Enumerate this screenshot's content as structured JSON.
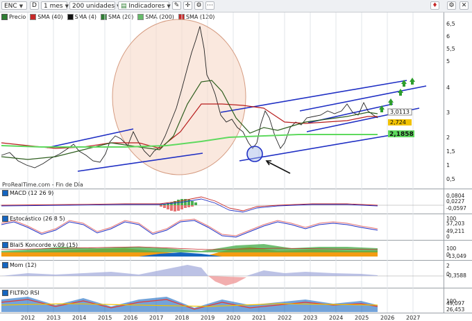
{
  "toolbar": {
    "ticker": "ENC",
    "d_label": "D",
    "period": "1 mes",
    "units": "200 unidades",
    "indicators": "Indicadores"
  },
  "legend": [
    {
      "label": "Precio",
      "color": "#333333"
    },
    {
      "label": "SMA (40)",
      "color": "#c62828"
    },
    {
      "label": "SMA (4)",
      "color": "#111111"
    },
    {
      "label": "SMA (20)",
      "color": "#2e7d32"
    },
    {
      "label": "SMA (200)",
      "color": "#66bb6a"
    },
    {
      "label": "SMA (120)",
      "color": "#c62828"
    }
  ],
  "source_label": "ProRealTime.com - Fin de Día",
  "price_axis": {
    "ticks": [
      "6,5",
      "6",
      "5,5",
      "5",
      "4",
      "3",
      "2",
      "1,5",
      "1",
      "0,5"
    ]
  },
  "price_badges": {
    "p1": "3,0113",
    "p2": "2,724",
    "p3": "2,1858"
  },
  "panels": [
    {
      "label": "MACD (12 26 9)",
      "ticks": [
        "0,0804",
        "0,0227",
        "-0,0597"
      ]
    },
    {
      "label": "Estocástico (26 8 5)",
      "ticks": [
        "100",
        "57,203",
        "49,211",
        "0"
      ]
    },
    {
      "label": "Blai5 Koncorde v.09 (15)",
      "ticks": [
        "100",
        "0",
        "-13,049"
      ]
    },
    {
      "label": "Mom (12)",
      "ticks": [
        "2",
        "0",
        "-0,3588"
      ]
    },
    {
      "label": "FILTRO RSI",
      "ticks": [
        "100",
        "49,097",
        "26,453"
      ]
    }
  ],
  "x_axis": [
    "2012",
    "2013",
    "2014",
    "2015",
    "2016",
    "2017",
    "2018",
    "2019",
    "2020",
    "2021",
    "2022",
    "2023",
    "2024",
    "2025",
    "2026",
    "2027"
  ]
}
